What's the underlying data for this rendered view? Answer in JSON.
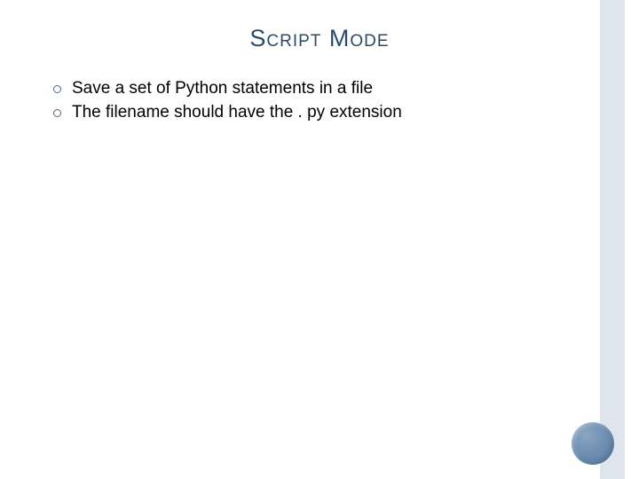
{
  "slide": {
    "title": "Script Mode",
    "bullets": [
      "Save a set of Python statements in a file",
      "The filename should have the . py extension"
    ]
  }
}
